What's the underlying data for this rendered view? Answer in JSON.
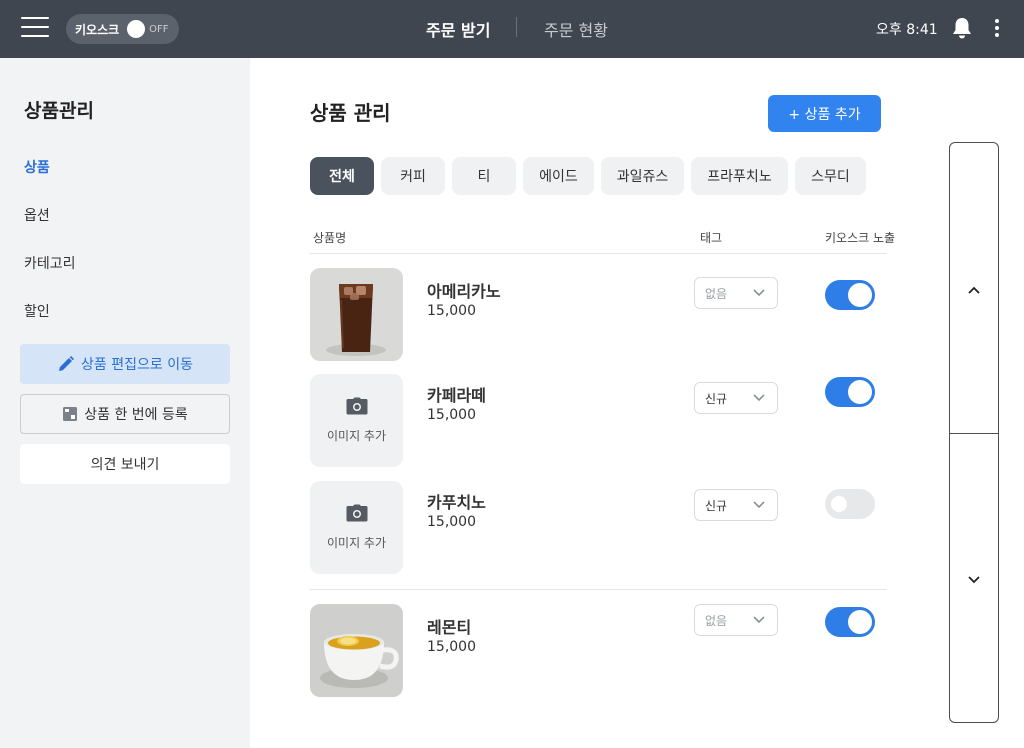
{
  "topbar": {
    "kiosk_label": "키오스크",
    "kiosk_state": "OFF",
    "tab_order": "주문 받기",
    "tab_status": "주문 현황",
    "clock": "오후 8:41"
  },
  "sidebar": {
    "title": "상품관리",
    "items": [
      {
        "label": "상품"
      },
      {
        "label": "옵션"
      },
      {
        "label": "카테고리"
      },
      {
        "label": "할인"
      }
    ],
    "edit_button": "상품 편집으로 이동",
    "bulk_button": "상품 한 번에 등록",
    "feedback_button": "의견 보내기"
  },
  "main": {
    "title": "상품 관리",
    "add_button": "+ 상품 추가",
    "categories": [
      "전체",
      "커피",
      "티",
      "에이드",
      "과일쥬스",
      "프라푸치노",
      "스무디"
    ],
    "columns": {
      "name": "상품명",
      "tag": "태그",
      "kiosk": "키오스크 노출"
    },
    "add_image_label": "이미지 추가",
    "products": [
      {
        "name": "아메리카노",
        "price": "15,000",
        "tag": "없음",
        "kiosk_visible": true
      },
      {
        "name": "카페라떼",
        "price": "15,000",
        "tag": "신규",
        "kiosk_visible": true
      },
      {
        "name": "카푸치노",
        "price": "15,000",
        "tag": "신규",
        "kiosk_visible": false
      },
      {
        "name": "레몬티",
        "price": "15,000",
        "tag": "없음",
        "kiosk_visible": true
      }
    ]
  },
  "colors": {
    "topbar": "#3f4650",
    "accent": "#3184f0",
    "sidebar_bg": "#f2f3f5",
    "chip_active": "#4a525d"
  },
  "icons": [
    "menu-icon",
    "bell-icon",
    "more-vertical-icon",
    "pencil-icon",
    "spreadsheet-icon",
    "camera-icon",
    "chevron-down-icon",
    "chevron-up-icon"
  ]
}
